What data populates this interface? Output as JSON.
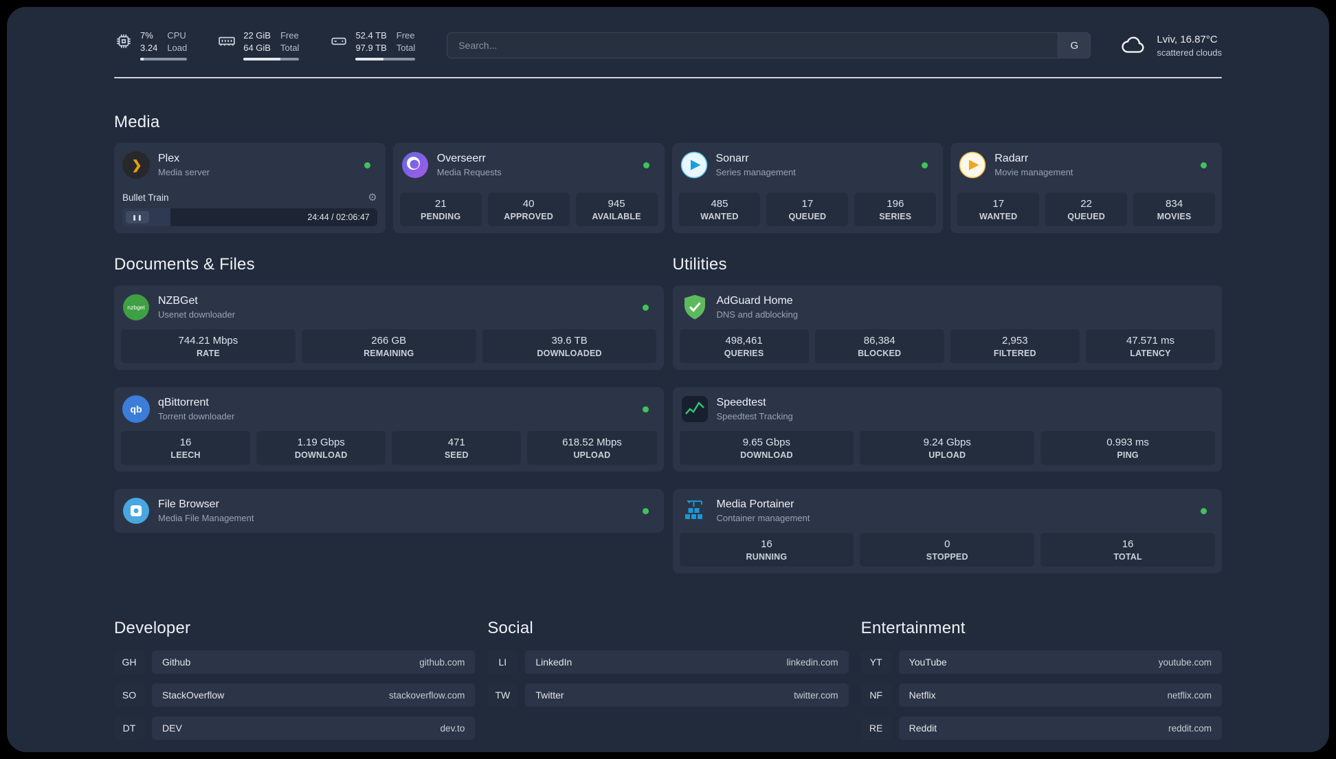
{
  "theme": {
    "background": "#222b3c",
    "card": "#2c3547",
    "tile": "#242d3e",
    "status_green": "#3fc35a",
    "plex_amber": "#e5a00d",
    "adguard_green": "#5eb95e",
    "portainer_blue": "#1899d6"
  },
  "icons": {
    "gear": "⚙",
    "pause": "❚❚",
    "plex_chevron": "❯",
    "qbittorrent_label": "qb",
    "nzbget_label": "nzbget"
  },
  "topbar": {
    "cpu": {
      "value_top": "7%",
      "value_bottom": "3.24",
      "label_top": "CPU",
      "label_bottom": "Load"
    },
    "ram": {
      "value_top": "22 GiB",
      "value_bottom": "64 GiB",
      "label_top": "Free",
      "label_bottom": "Total"
    },
    "disk": {
      "value_top": "52.4 TB",
      "value_bottom": "97.9 TB",
      "label_top": "Free",
      "label_bottom": "Total"
    },
    "search": {
      "placeholder": "Search...",
      "button": "G"
    },
    "weather": {
      "location": "Lviv, 16.87°C",
      "condition": "scattered clouds"
    }
  },
  "media": {
    "title": "Media",
    "plex": {
      "name": "Plex",
      "subtitle": "Media server",
      "player": {
        "track": "Bullet Train",
        "time": "24:44 / 02:06:47"
      }
    },
    "overseerr": {
      "name": "Overseerr",
      "subtitle": "Media Requests",
      "stats": [
        {
          "value": "21",
          "label": "PENDING"
        },
        {
          "value": "40",
          "label": "APPROVED"
        },
        {
          "value": "945",
          "label": "AVAILABLE"
        }
      ]
    },
    "sonarr": {
      "name": "Sonarr",
      "subtitle": "Series management",
      "stats": [
        {
          "value": "485",
          "label": "WANTED"
        },
        {
          "value": "17",
          "label": "QUEUED"
        },
        {
          "value": "196",
          "label": "SERIES"
        }
      ]
    },
    "radarr": {
      "name": "Radarr",
      "subtitle": "Movie management",
      "stats": [
        {
          "value": "17",
          "label": "WANTED"
        },
        {
          "value": "22",
          "label": "QUEUED"
        },
        {
          "value": "834",
          "label": "MOVIES"
        }
      ]
    }
  },
  "documents": {
    "title": "Documents & Files",
    "nzbget": {
      "name": "NZBGet",
      "subtitle": "Usenet downloader",
      "stats": [
        {
          "value": "744.21 Mbps",
          "label": "RATE"
        },
        {
          "value": "266 GB",
          "label": "REMAINING"
        },
        {
          "value": "39.6 TB",
          "label": "DOWNLOADED"
        }
      ]
    },
    "qbittorrent": {
      "name": "qBittorrent",
      "subtitle": "Torrent downloader",
      "stats": [
        {
          "value": "16",
          "label": "LEECH"
        },
        {
          "value": "1.19 Gbps",
          "label": "DOWNLOAD"
        },
        {
          "value": "471",
          "label": "SEED"
        },
        {
          "value": "618.52 Mbps",
          "label": "UPLOAD"
        }
      ]
    },
    "filebrowser": {
      "name": "File Browser",
      "subtitle": "Media File Management"
    }
  },
  "utilities": {
    "title": "Utilities",
    "adguard": {
      "name": "AdGuard Home",
      "subtitle": "DNS and adblocking",
      "stats": [
        {
          "value": "498,461",
          "label": "QUERIES"
        },
        {
          "value": "86,384",
          "label": "BLOCKED"
        },
        {
          "value": "2,953",
          "label": "FILTERED"
        },
        {
          "value": "47.571 ms",
          "label": "LATENCY"
        }
      ]
    },
    "speedtest": {
      "name": "Speedtest",
      "subtitle": "Speedtest Tracking",
      "stats": [
        {
          "value": "9.65 Gbps",
          "label": "DOWNLOAD"
        },
        {
          "value": "9.24 Gbps",
          "label": "UPLOAD"
        },
        {
          "value": "0.993 ms",
          "label": "PING"
        }
      ]
    },
    "portainer": {
      "name": "Media Portainer",
      "subtitle": "Container management",
      "stats": [
        {
          "value": "16",
          "label": "RUNNING"
        },
        {
          "value": "0",
          "label": "STOPPED"
        },
        {
          "value": "16",
          "label": "TOTAL"
        }
      ]
    }
  },
  "links": {
    "developer": {
      "title": "Developer",
      "items": [
        {
          "abbr": "GH",
          "name": "Github",
          "url": "github.com"
        },
        {
          "abbr": "SO",
          "name": "StackOverflow",
          "url": "stackoverflow.com"
        },
        {
          "abbr": "DT",
          "name": "DEV",
          "url": "dev.to"
        }
      ]
    },
    "social": {
      "title": "Social",
      "items": [
        {
          "abbr": "LI",
          "name": "LinkedIn",
          "url": "linkedin.com"
        },
        {
          "abbr": "TW",
          "name": "Twitter",
          "url": "twitter.com"
        }
      ]
    },
    "entertainment": {
      "title": "Entertainment",
      "items": [
        {
          "abbr": "YT",
          "name": "YouTube",
          "url": "youtube.com"
        },
        {
          "abbr": "NF",
          "name": "Netflix",
          "url": "netflix.com"
        },
        {
          "abbr": "RE",
          "name": "Reddit",
          "url": "reddit.com"
        }
      ]
    }
  }
}
